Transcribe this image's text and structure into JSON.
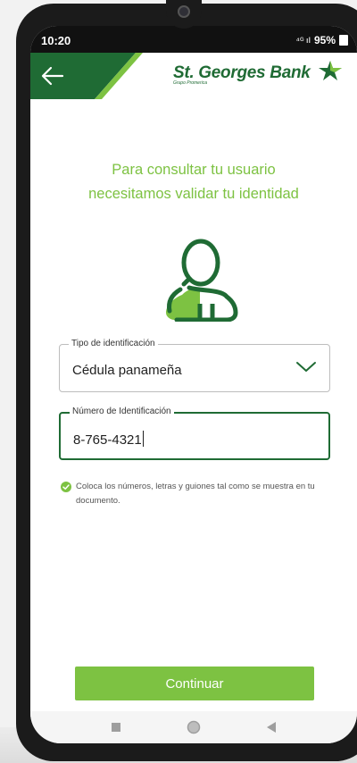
{
  "status_bar": {
    "time": "10:20",
    "signal": "⁴ᴳ ıl",
    "battery": "95%"
  },
  "header": {
    "logo_text": "St. Georges Bank",
    "logo_sub": "Grupo Promerica"
  },
  "main": {
    "title_line1": "Para consultar tu usuario",
    "title_line2": "necesitamos validar tu identidad",
    "id_type": {
      "label": "Tipo de identificación",
      "value": "Cédula panameña"
    },
    "id_number": {
      "label": "Número de Identificación",
      "value": "8-765-4321"
    },
    "hint": "Coloca los números, letras y guiones tal como se muestra en tu documento."
  },
  "actions": {
    "continue_label": "Continuar"
  },
  "colors": {
    "brand_dark": "#1f6b34",
    "brand_light": "#7dc242"
  }
}
